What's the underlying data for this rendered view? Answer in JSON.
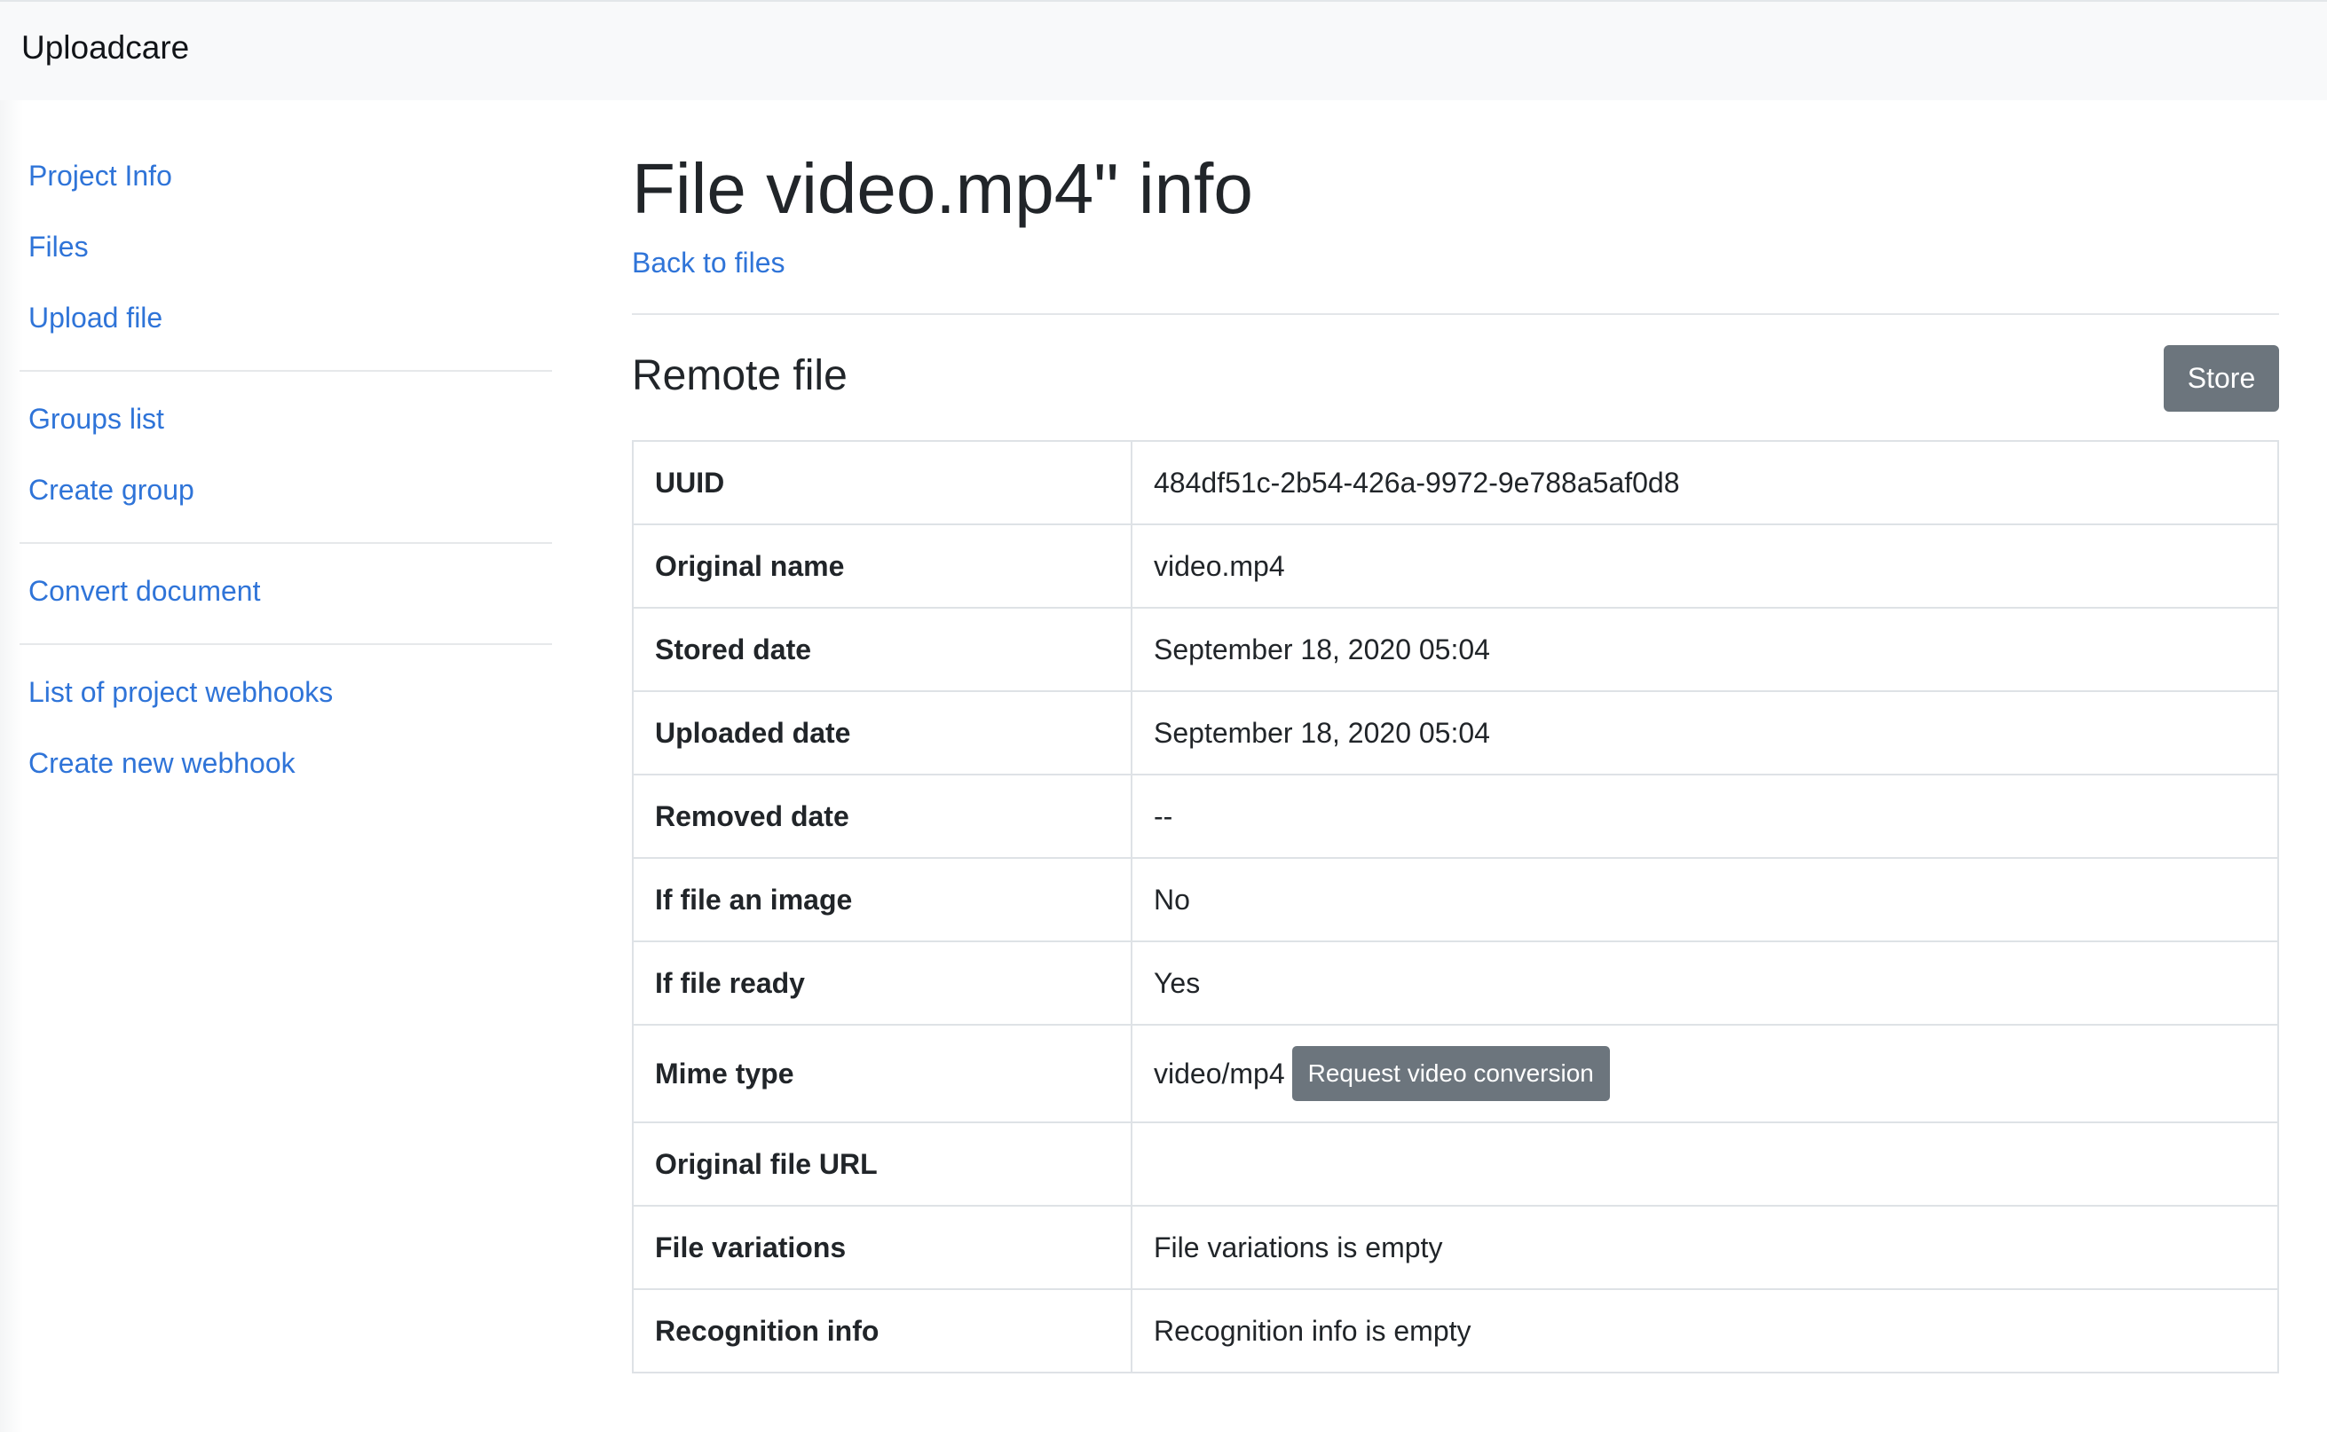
{
  "header": {
    "brand": "Uploadcare"
  },
  "sidebar": {
    "groups": [
      {
        "items": [
          {
            "label": "Project Info"
          },
          {
            "label": "Files"
          },
          {
            "label": "Upload file"
          }
        ]
      },
      {
        "items": [
          {
            "label": "Groups list"
          },
          {
            "label": "Create group"
          }
        ]
      },
      {
        "items": [
          {
            "label": "Convert document"
          }
        ]
      },
      {
        "items": [
          {
            "label": "List of project webhooks"
          },
          {
            "label": "Create new webhook"
          }
        ]
      }
    ]
  },
  "main": {
    "title": "File video.mp4\" info",
    "back_link": "Back to files",
    "section_title": "Remote file",
    "store_button": "Store",
    "table": {
      "rows": [
        {
          "label": "UUID",
          "value": "484df51c-2b54-426a-9972-9e788a5af0d8"
        },
        {
          "label": "Original name",
          "value": "video.mp4"
        },
        {
          "label": "Stored date",
          "value": "September 18, 2020 05:04"
        },
        {
          "label": "Uploaded date",
          "value": "September 18, 2020 05:04"
        },
        {
          "label": "Removed date",
          "value": "--"
        },
        {
          "label": "If file an image",
          "value": "No"
        },
        {
          "label": "If file ready",
          "value": "Yes"
        },
        {
          "label": "Mime type",
          "value": "video/mp4",
          "action": "Request video conversion"
        },
        {
          "label": "Original file URL",
          "value": ""
        },
        {
          "label": "File variations",
          "value": "File variations is empty"
        },
        {
          "label": "Recognition info",
          "value": "Recognition info is empty"
        }
      ]
    }
  },
  "colors": {
    "link": "#2f74d8",
    "navbar_bg": "#f8f9fa",
    "button_bg": "#6c757d",
    "border": "#dee2e6",
    "text": "#212529"
  }
}
